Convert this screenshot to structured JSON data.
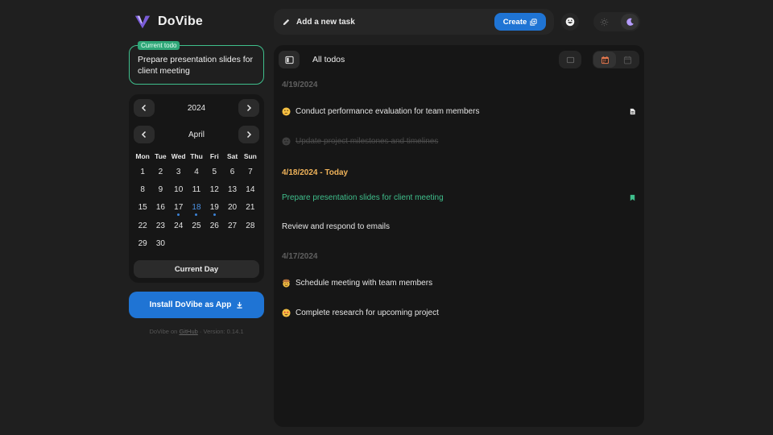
{
  "app": {
    "name": "DoVibe"
  },
  "current_todo": {
    "tag": "Current todo",
    "text": "Prepare presentation slides for client meeting"
  },
  "calendar": {
    "year": "2024",
    "month": "April",
    "weekdays": [
      "Mon",
      "Tue",
      "Wed",
      "Thu",
      "Fri",
      "Sat",
      "Sun"
    ],
    "days": [
      "1",
      "2",
      "3",
      "4",
      "5",
      "6",
      "7",
      "8",
      "9",
      "10",
      "11",
      "12",
      "13",
      "14",
      "15",
      "16",
      "17",
      "18",
      "19",
      "20",
      "21",
      "22",
      "23",
      "24",
      "25",
      "26",
      "27",
      "28",
      "29",
      "30"
    ],
    "today": "18",
    "days_with_tasks": [
      "17",
      "18",
      "19"
    ],
    "current_day_label": "Current Day"
  },
  "install": {
    "label": "Install DoVibe as App"
  },
  "footer": {
    "prefix": "DoVibe on",
    "link": "GitHub",
    "version": "Version: 0.14.1"
  },
  "topbar": {
    "add_task_placeholder": "Add a new task",
    "create_label": "Create",
    "theme_options": [
      "light",
      "dark"
    ],
    "active_theme": "dark"
  },
  "main": {
    "title": "All todos",
    "view_options": [
      "calendar-view",
      "week-view"
    ],
    "active_view": "calendar-view",
    "groups": [
      {
        "date": "4/19/2024",
        "is_today": false,
        "todos": [
          {
            "text": "Conduct performance evaluation for team members",
            "emoji": "thinking-face",
            "state": "normal",
            "right_icon": "note-icon"
          },
          {
            "text": "Update project milestones and timelines",
            "emoji": "neutral-face",
            "state": "done",
            "right_icon": ""
          }
        ]
      },
      {
        "date": "4/18/2024 - Today",
        "is_today": true,
        "todos": [
          {
            "text": "Prepare presentation slides for client meeting",
            "emoji": "",
            "state": "active",
            "right_icon": "bookmark-icon"
          },
          {
            "text": "Review and respond to emails",
            "emoji": "",
            "state": "normal",
            "right_icon": ""
          }
        ]
      },
      {
        "date": "4/17/2024",
        "is_today": false,
        "todos": [
          {
            "text": "Schedule meeting with team members",
            "emoji": "face-with-cowboy-hat",
            "state": "normal",
            "right_icon": ""
          },
          {
            "text": "Complete research for upcoming project",
            "emoji": "star-struck-face",
            "state": "normal",
            "right_icon": ""
          }
        ]
      }
    ]
  },
  "colors": {
    "accent": "#1f74d4",
    "green": "#3fbf8c",
    "today_header": "#f0b35a",
    "background": "#1f1f1f",
    "panel": "#161616"
  }
}
